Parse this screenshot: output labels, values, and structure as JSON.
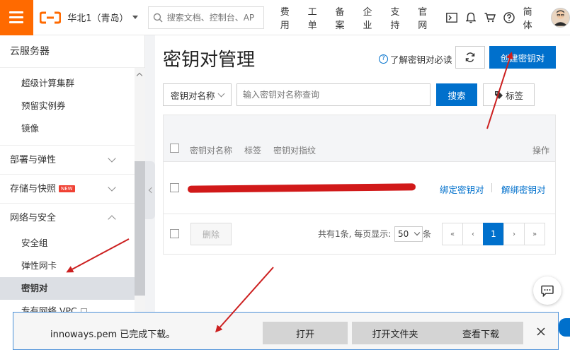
{
  "topbar": {
    "region": "华北1（青岛）",
    "search_placeholder": "搜索文档、控制台、AP",
    "nav": [
      "费用",
      "工单",
      "备案",
      "企业",
      "支持",
      "官网"
    ],
    "lang": "简体"
  },
  "sidebar": {
    "title": "云服务器",
    "items_top": [
      "超级计算集群",
      "预留实例券",
      "镜像"
    ],
    "groups": {
      "deploy": "部署与弹性",
      "storage": "存储与快照",
      "storage_badge": "NEW",
      "network": "网络与安全"
    },
    "network_items": [
      "安全组",
      "弹性网卡",
      "密钥对",
      "专有网络 VPC"
    ]
  },
  "main": {
    "title": "密钥对管理",
    "help_link": "了解密钥对必读",
    "create_button": "创建密钥对",
    "filter_select": "密钥对名称",
    "filter_placeholder": "输入密钥对名称查询",
    "search_button": "搜索",
    "tag_button": "标签",
    "table": {
      "columns": [
        "密钥对名称",
        "标签",
        "密钥对指纹",
        "操作"
      ],
      "row_actions": [
        "绑定密钥对",
        "解绑密钥对"
      ]
    },
    "footer": {
      "delete_button": "删除",
      "total_text": "共有1条, 每页显示:",
      "page_size": "50",
      "page_unit": "条",
      "current_page": "1",
      "first": "«",
      "prev": "‹",
      "next": "›",
      "last": "»"
    }
  },
  "download_bar": {
    "message": "innoways.pem 已完成下载。",
    "open": "打开",
    "open_folder": "打开文件夹",
    "view_downloads": "查看下载"
  },
  "colors": {
    "brand_orange": "#ff6a00",
    "primary_blue": "#0070cc",
    "annotation_red": "#cc1f1f"
  }
}
